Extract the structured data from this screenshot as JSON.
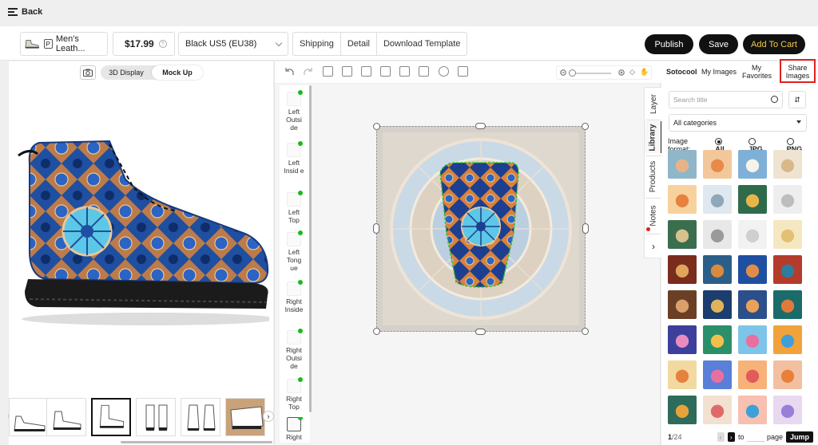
{
  "topbar": {
    "back_label": "Back"
  },
  "toolbar": {
    "product_name": "Men's Leath...",
    "product_badge": "P",
    "price": "$17.99",
    "variant": "Black US5 (EU38)",
    "tabs": [
      "Shipping",
      "Detail",
      "Download Template"
    ],
    "publish_label": "Publish",
    "save_label": "Save",
    "add_to_cart_label": "Add To Cart",
    "add_to_cart_color": "#f2c94c"
  },
  "preview": {
    "display_modes": [
      "3D Display",
      "Mock Up"
    ],
    "active_mode": "Mock Up"
  },
  "parts": [
    {
      "label": "Left Outsi de"
    },
    {
      "label": "Left Insid e"
    },
    {
      "label": "Left Top"
    },
    {
      "label": "Left Tong ue"
    },
    {
      "label": "Right Inside"
    },
    {
      "label": "Right Outsi de"
    },
    {
      "label": "Right Top"
    },
    {
      "label": "Right"
    }
  ],
  "side_tabs": [
    "Layer",
    "Library",
    "Products",
    "Notes"
  ],
  "side_tab_active": "Library",
  "library": {
    "tabs": [
      "Sotocool",
      "My Images",
      "My Favorites",
      "Share Images"
    ],
    "active_tab": "Sotocool",
    "highlight_tab": "Share Images",
    "search_placeholder": "Search title",
    "category": "All categories",
    "format_label": "Image format:",
    "formats": [
      "All",
      "JPG",
      "PNG"
    ],
    "selected_format": "All",
    "page_current": "1",
    "page_total": "/24",
    "to_label": "to",
    "page_label": "page",
    "jump_label": "Jump"
  },
  "colors": {
    "accent_red": "#e02020",
    "status_green": "#1aba1a",
    "dark": "#111111"
  }
}
